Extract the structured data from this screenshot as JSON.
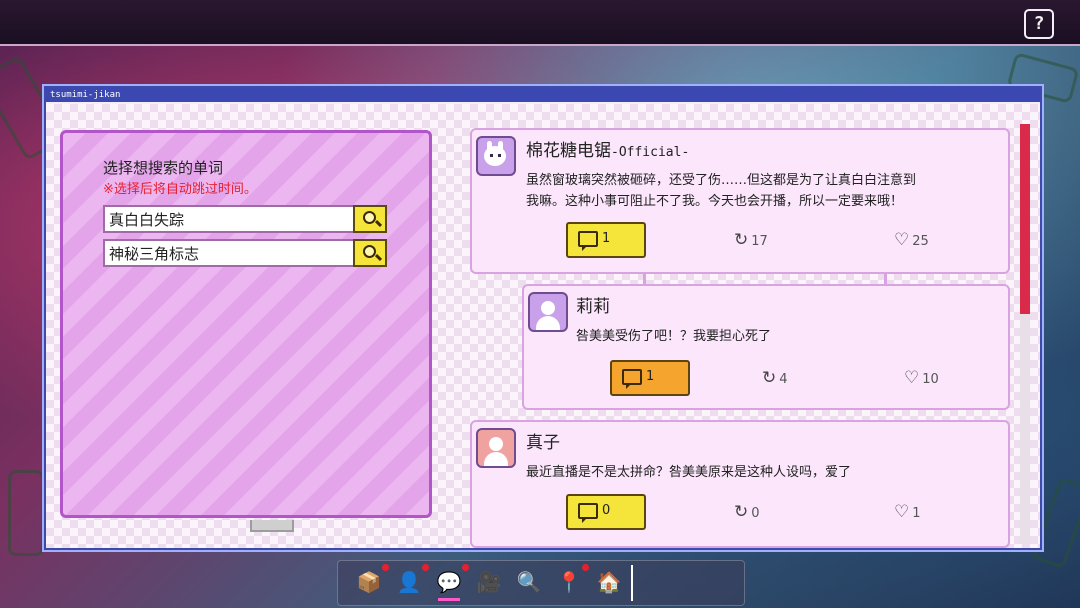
{
  "window": {
    "title": "tsumimi-jikan"
  },
  "help": {
    "label": "?"
  },
  "search": {
    "title": "选择想搜索的单词",
    "note": "※选择后将自动跳过时间。",
    "keywords": [
      {
        "label": "真白白失踪"
      },
      {
        "label": "神秘三角标志"
      }
    ]
  },
  "feed": {
    "posts": [
      {
        "name": "棉花糖电锯",
        "tag": "-Official-",
        "text_line1": "虽然窗玻璃突然被砸碎，还受了伤……但这都是为了让真白白注意到",
        "text_line2": "我嘛。这种小事可阻止不了我。今天也会开播，所以一定要来哦！",
        "replies": "1",
        "reposts": "17",
        "likes": "25"
      },
      {
        "name": "莉莉",
        "text_line1": "咎美美受伤了吧！？我要担心死了",
        "replies": "1",
        "reposts": "4",
        "likes": "10"
      },
      {
        "name": "真子",
        "text_line1": "最近直播是不是太拼命？咎美美原来是这种人设吗，爱了",
        "replies": "0",
        "reposts": "0",
        "likes": "1"
      }
    ]
  },
  "icons": {
    "repost": "↻",
    "like": "♡"
  },
  "dock": {
    "items": [
      {
        "name": "package-icon",
        "glyph": "📦"
      },
      {
        "name": "character-icon",
        "glyph": "👤"
      },
      {
        "name": "social-feed-icon",
        "glyph": "💬"
      },
      {
        "name": "streaming-icon",
        "glyph": "🎥"
      },
      {
        "name": "search-icon",
        "glyph": "🔍"
      },
      {
        "name": "map-icon",
        "glyph": "📍"
      },
      {
        "name": "home-icon",
        "glyph": "🏠"
      }
    ]
  },
  "colors": {
    "reply_active": "#f5a42e",
    "reply_default": "#f5e53a",
    "scroll_thumb": "#d92a4a",
    "note_red": "#e8202e"
  }
}
